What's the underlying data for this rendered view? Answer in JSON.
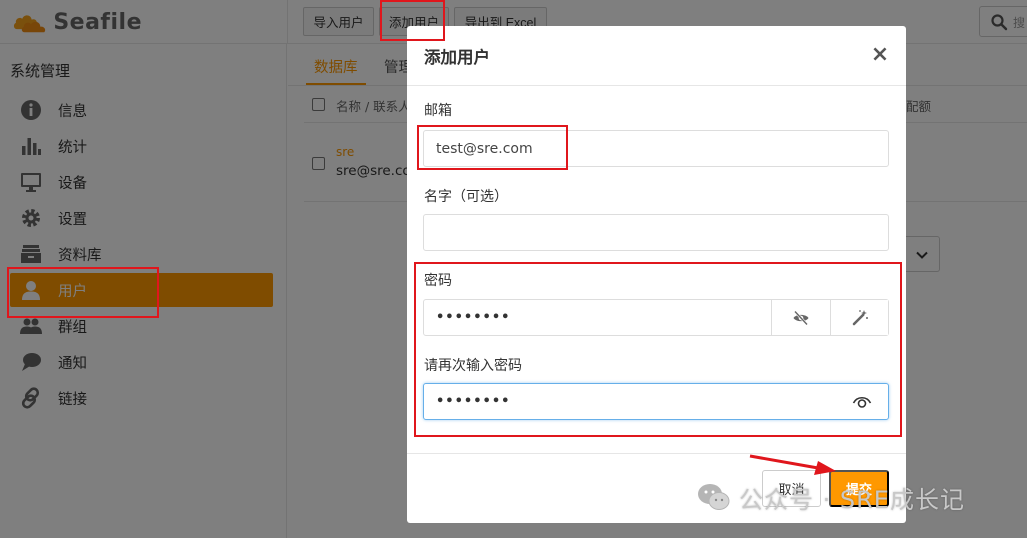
{
  "app": {
    "logo_text": "Seafile"
  },
  "toolbar": {
    "import_label": "导入用户",
    "add_label": "添加用户",
    "export_label": "导出到 Excel",
    "search_placeholder": "搜"
  },
  "sidebar": {
    "title": "系统管理",
    "items": [
      {
        "label": "信息",
        "icon": "info-icon"
      },
      {
        "label": "统计",
        "icon": "bar-chart-icon"
      },
      {
        "label": "设备",
        "icon": "monitor-icon"
      },
      {
        "label": "设置",
        "icon": "gear-icon"
      },
      {
        "label": "资料库",
        "icon": "library-icon"
      },
      {
        "label": "用户",
        "icon": "user-icon",
        "active": true
      },
      {
        "label": "群组",
        "icon": "group-icon"
      },
      {
        "label": "通知",
        "icon": "chat-icon"
      },
      {
        "label": "链接",
        "icon": "link-icon"
      }
    ]
  },
  "main": {
    "tabs": [
      {
        "label": "数据库"
      },
      {
        "label": "管理"
      }
    ],
    "columns": {
      "name": "名称 / 联系人",
      "quota": "配额"
    },
    "rows": [
      {
        "name": "sre",
        "email": "sre@sre.com"
      }
    ]
  },
  "modal": {
    "title": "添加用户",
    "close_glyph": "×",
    "email_label": "邮箱",
    "email_value": "test@sre.com",
    "name_label": "名字（可选）",
    "name_value": "",
    "password_label": "密码",
    "password_value": "••••••••",
    "confirm_label": "请再次输入密码",
    "confirm_value": "••••••••",
    "cancel_label": "取消",
    "submit_label": "提交"
  },
  "watermark": {
    "text": "公众号 · SRE成长记"
  },
  "colors": {
    "accent": "#ff9800",
    "annotation": "#e0161c",
    "focus": "#66afe9"
  }
}
